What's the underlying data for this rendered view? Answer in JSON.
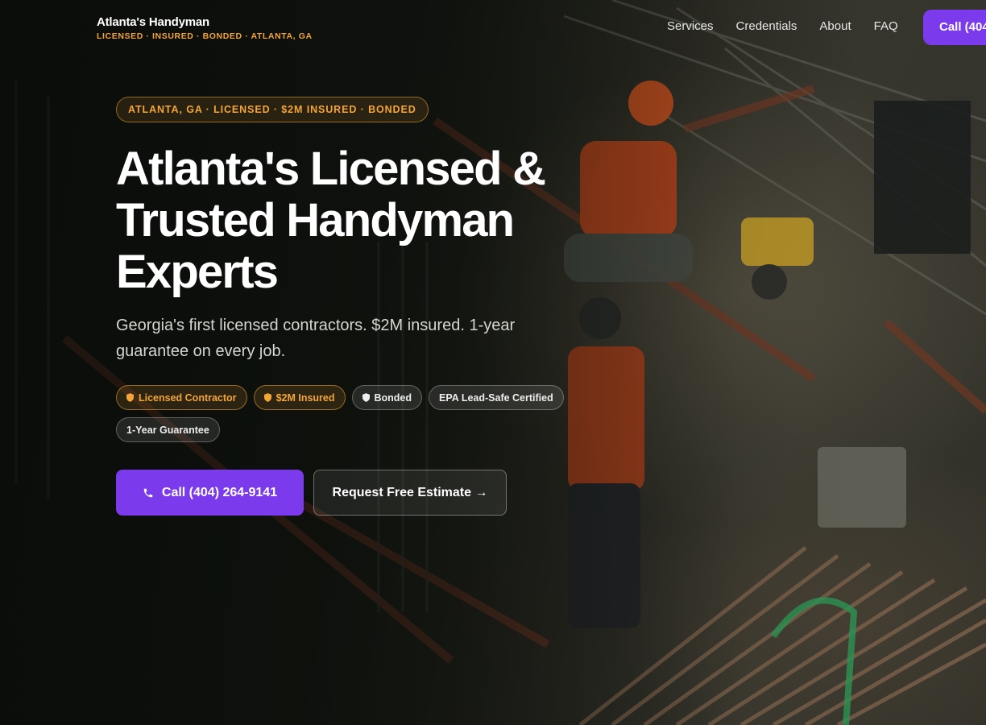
{
  "header": {
    "brand_name": "Atlanta's Handyman",
    "brand_tagline": "LICENSED · INSURED · BONDED · ATLANTA, GA",
    "nav": [
      "Services",
      "Credentials",
      "About",
      "FAQ"
    ],
    "call_label": "Call (404"
  },
  "hero": {
    "eyebrow": "ATLANTA, GA · LICENSED · $2M INSURED · BONDED",
    "headline": "Atlanta's Licensed & Trusted Handyman Experts",
    "subheadline": "Georgia's first licensed contractors. $2M insured. 1-year guarantee on every job.",
    "badges": [
      {
        "label": "Licensed Contractor",
        "style": "gold",
        "icon": "shield-icon"
      },
      {
        "label": "$2M Insured",
        "style": "gold",
        "icon": "shield-icon"
      },
      {
        "label": "Bonded",
        "style": "grey",
        "icon": "shield-icon"
      },
      {
        "label": "EPA Lead-Safe Certified",
        "style": "grey"
      },
      {
        "label": "1-Year Guarantee",
        "style": "grey"
      }
    ],
    "primary_cta": "Call (404) 264-9141",
    "secondary_cta": "Request Free Estimate →"
  },
  "colors": {
    "accent": "#7c3aed",
    "gold": "#f3a537",
    "background": "#15160f"
  }
}
